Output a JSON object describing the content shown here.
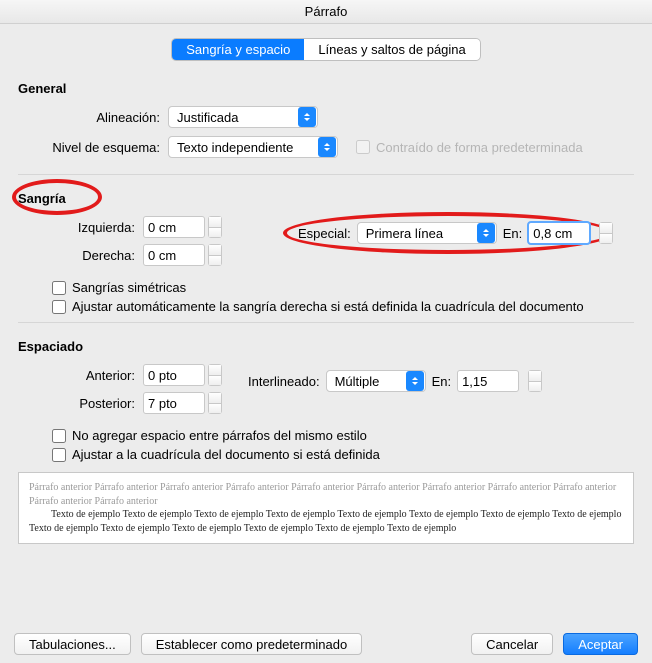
{
  "title": "Párrafo",
  "tabs": {
    "a": "Sangría y espacio",
    "b": "Líneas y saltos de página"
  },
  "general": {
    "heading": "General",
    "align_label": "Alineación:",
    "align_value": "Justificada",
    "outline_label": "Nivel de esquema:",
    "outline_value": "Texto independiente",
    "collapsed_label": "Contraído de forma predeterminada"
  },
  "indent": {
    "heading": "Sangría",
    "left_label": "Izquierda:",
    "left_value": "0 cm",
    "right_label": "Derecha:",
    "right_value": "0 cm",
    "special_label": "Especial:",
    "special_value": "Primera línea",
    "by_label": "En:",
    "by_value": "0,8 cm",
    "mirror_label": "Sangrías simétricas",
    "autoright_label": "Ajustar automáticamente la sangría derecha si está definida la cuadrícula del documento"
  },
  "spacing": {
    "heading": "Espaciado",
    "before_label": "Anterior:",
    "before_value": "0 pto",
    "after_label": "Posterior:",
    "after_value": "7 pto",
    "line_label": "Interlineado:",
    "line_value": "Múltiple",
    "at_label": "En:",
    "at_value": "1,15",
    "nospace_label": "No agregar espacio entre párrafos del mismo estilo",
    "snapgrid_label": "Ajustar a la cuadrícula del documento si está definida"
  },
  "preview": {
    "prev": "Párrafo anterior Párrafo anterior Párrafo anterior Párrafo anterior Párrafo anterior Párrafo anterior Párrafo anterior Párrafo anterior Párrafo anterior Párrafo anterior Párrafo anterior",
    "sample": "Texto de ejemplo Texto de ejemplo Texto de ejemplo Texto de ejemplo Texto de ejemplo Texto de ejemplo Texto de ejemplo Texto de ejemplo Texto de ejemplo Texto de ejemplo Texto de ejemplo Texto de ejemplo Texto de ejemplo Texto de ejemplo"
  },
  "footer": {
    "tabs_btn": "Tabulaciones...",
    "default_btn": "Establecer como predeterminado",
    "cancel": "Cancelar",
    "ok": "Aceptar"
  }
}
